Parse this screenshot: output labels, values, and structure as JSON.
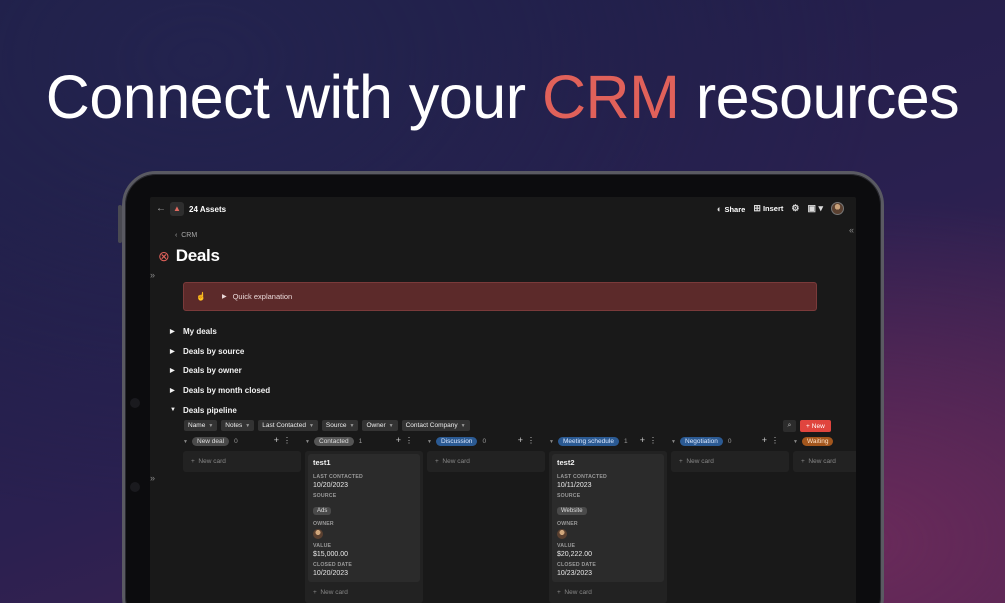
{
  "headline": {
    "before": "Connect with your ",
    "accent": "CRM",
    "after": " resources"
  },
  "colors": {
    "accent": "#e0615a",
    "new_button": "#e0453e",
    "callout_bg": "#5c2a2a"
  },
  "topbar": {
    "workspace_title": "24 Assets",
    "share_label": "Share",
    "insert_label": "Insert"
  },
  "breadcrumb": {
    "parent": "CRM"
  },
  "page": {
    "title": "Deals"
  },
  "callout": {
    "label": "Quick explanation"
  },
  "toggles": [
    {
      "label": "My deals"
    },
    {
      "label": "Deals by source"
    },
    {
      "label": "Deals by owner"
    },
    {
      "label": "Deals by month closed"
    },
    {
      "label": "Deals pipeline"
    }
  ],
  "filters": [
    "Name",
    "Notes",
    "Last Contacted",
    "Source",
    "Owner",
    "Contact Company"
  ],
  "board": {
    "new_label": "New",
    "new_card_label": "New card",
    "columns": [
      {
        "name": "New deal",
        "count": "0",
        "color": "#4a4a4a"
      },
      {
        "name": "Contacted",
        "count": "1",
        "color": "#555555"
      },
      {
        "name": "Discussion",
        "count": "0",
        "color": "#2b5a93"
      },
      {
        "name": "Meeting schedule",
        "count": "1",
        "color": "#2b5a93"
      },
      {
        "name": "Negotiation",
        "count": "0",
        "color": "#2b5a93"
      },
      {
        "name": "Waiting",
        "count": "",
        "color": "#a2561d"
      }
    ],
    "field_labels": {
      "last_contacted": "LAST CONTACTED",
      "source": "SOURCE",
      "owner": "OWNER",
      "value": "VALUE",
      "closed_date": "CLOSED DATE"
    },
    "cards": [
      {
        "title": "test1",
        "last_contacted": "10/20/2023",
        "source": "Ads",
        "value": "$15,000.00",
        "closed_date": "10/20/2023"
      },
      {
        "title": "test2",
        "last_contacted": "10/11/2023",
        "source": "Website",
        "value": "$20,222.00",
        "closed_date": "10/23/2023"
      }
    ]
  }
}
